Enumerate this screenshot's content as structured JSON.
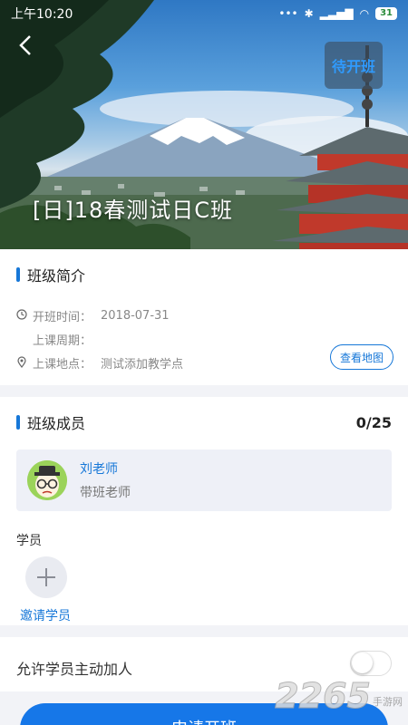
{
  "status_bar": {
    "time": "上午10:20",
    "battery": "31"
  },
  "header": {
    "status_tag": "待开班",
    "class_title": "[日]18春测试日C班"
  },
  "intro": {
    "title": "班级简介",
    "start_label": "开班时间：",
    "start_value": "2018-07-31",
    "cycle_label": "上课周期：",
    "cycle_value": "",
    "location_label": "上课地点：",
    "location_value": "测试添加教学点",
    "map_button": "查看地图"
  },
  "members": {
    "title": "班级成员",
    "count": "0/25",
    "teacher_name": "刘老师",
    "teacher_role": "带班老师",
    "students_label": "学员",
    "invite_label": "邀请学员"
  },
  "settings": {
    "allow_join_label": "允许学员主动加人",
    "allow_join_enabled": false
  },
  "footer": {
    "apply_button": "申请开班",
    "watermark_number": "2265",
    "watermark_text": "手游网"
  },
  "colors": {
    "accent": "#1677d8",
    "tag_text": "#2f9bff"
  }
}
